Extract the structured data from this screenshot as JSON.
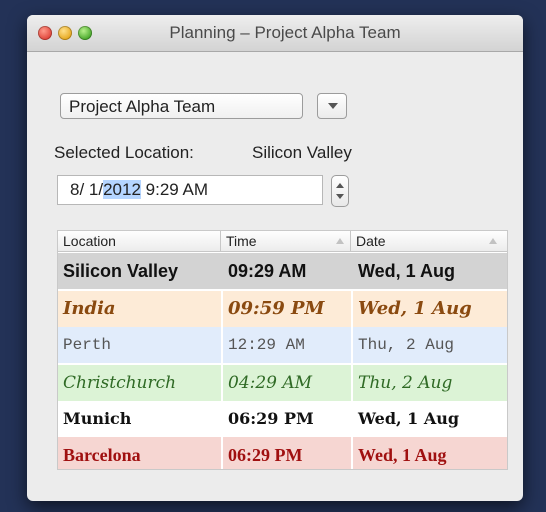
{
  "window": {
    "title": "Planning – Project Alpha Team"
  },
  "team_popup": {
    "selected": "Project Alpha Team"
  },
  "selected_location": {
    "label": "Selected Location:",
    "value": "Silicon Valley"
  },
  "datetime": {
    "month_day": "8/ 1/",
    "year": "2012",
    "time": " 9:29 AM"
  },
  "table": {
    "columns": [
      "Location",
      "Time",
      "Date"
    ],
    "rows": [
      {
        "location": "Silicon Valley",
        "time": "09:29 AM",
        "date": "Wed, 1 Aug"
      },
      {
        "location": "India",
        "time": "09:59 PM",
        "date": "Wed, 1 Aug"
      },
      {
        "location": "Perth",
        "time": "12:29 AM",
        "date": "Thu, 2 Aug"
      },
      {
        "location": "Christchurch",
        "time": "04:29 AM",
        "date": "Thu, 2 Aug"
      },
      {
        "location": "Munich",
        "time": "06:29 PM",
        "date": "Wed, 1 Aug"
      },
      {
        "location": "Barcelona",
        "time": "06:29 PM",
        "date": "Wed, 1 Aug"
      }
    ]
  },
  "icons": {
    "close": "close-button-icon",
    "minimize": "minimize-button-icon",
    "zoom": "zoom-button-icon",
    "popup_arrow": "chevron-down-icon",
    "stepper": "stepper-icon",
    "sort": "sort-ascending-icon"
  }
}
